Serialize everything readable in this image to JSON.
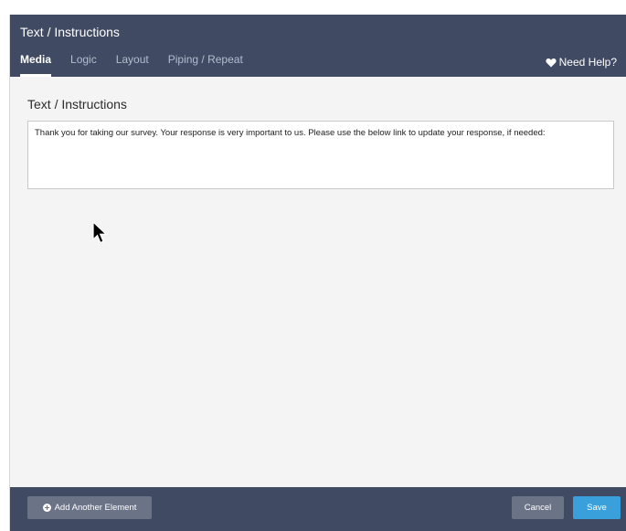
{
  "header": {
    "title": "Text / Instructions",
    "tabs": [
      {
        "label": "Media",
        "active": true
      },
      {
        "label": "Logic",
        "active": false
      },
      {
        "label": "Layout",
        "active": false
      },
      {
        "label": "Piping / Repeat",
        "active": false
      }
    ],
    "help_label": "Need Help?",
    "help_icon": "heart-icon"
  },
  "body": {
    "section_label": "Text / Instructions",
    "text_value": "Thank you for taking our survey. Your response is very important to us. Please use the below link to update your response, if needed:"
  },
  "footer": {
    "add_label": "Add Another Element",
    "add_icon": "plus-circle-icon",
    "cancel_label": "Cancel",
    "save_label": "Save"
  },
  "colors": {
    "header_bg": "#404a63",
    "save_bg": "#3aa0db",
    "secondary_btn": "#6b7387"
  }
}
